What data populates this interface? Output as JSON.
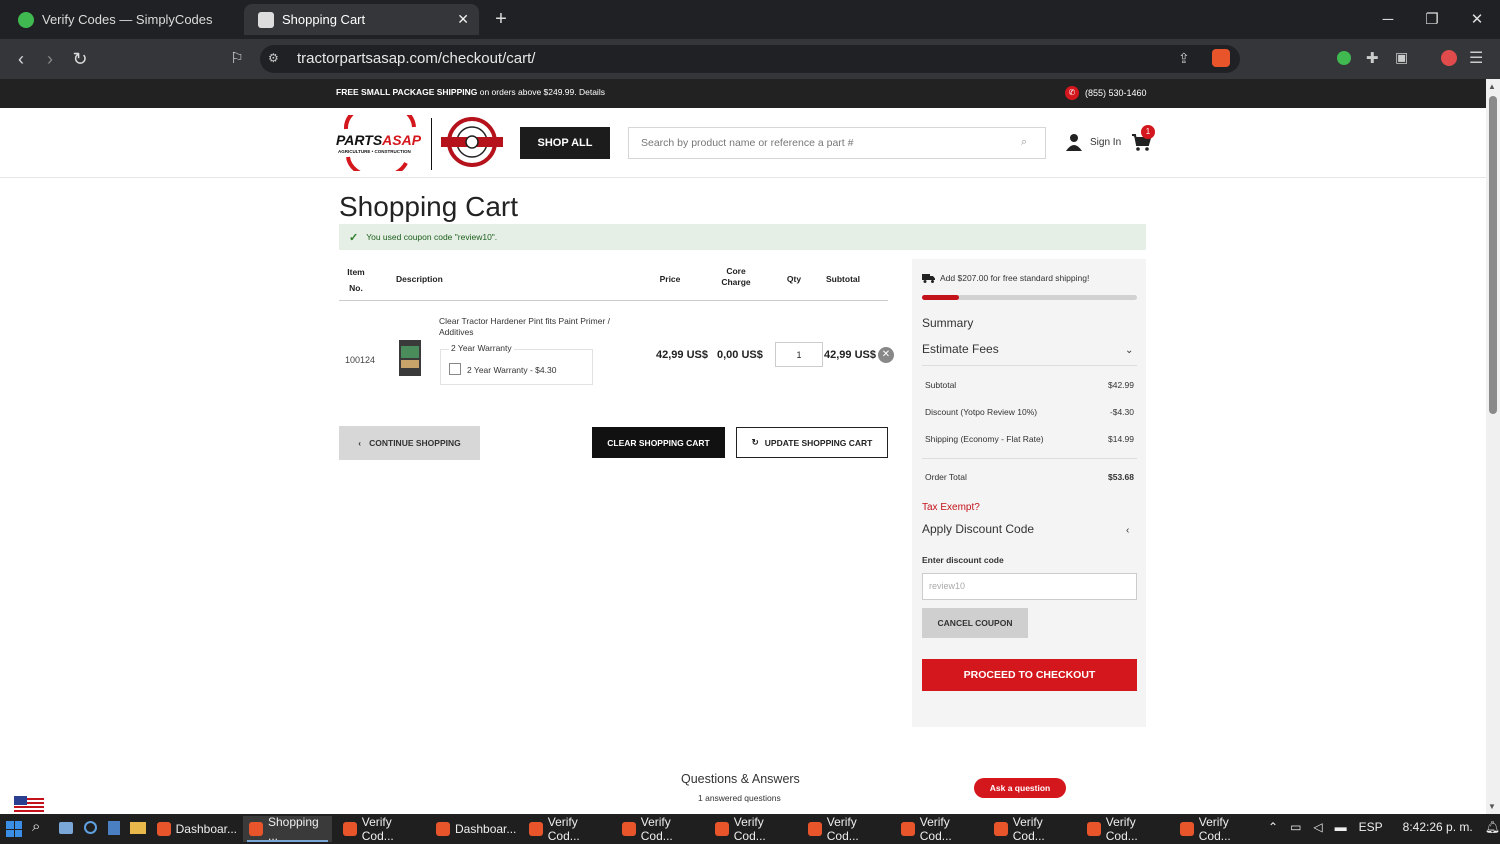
{
  "browser": {
    "tabs": [
      {
        "label": "Verify Codes — SimplyCodes",
        "active": false
      },
      {
        "label": "Shopping Cart",
        "active": true
      }
    ],
    "url": "tractorpartsasap.com/checkout/cart/"
  },
  "site": {
    "promo_bold": "FREE SMALL PACKAGE SHIPPING",
    "promo_rest": " on orders above $249.99. Details",
    "phone": "(855) 530-1460",
    "shop_all": "SHOP ALL",
    "search_placeholder": "Search by product name or reference a part #",
    "sign_in": "Sign In",
    "cart_count": "1",
    "logo_text": "PARTSASAP",
    "logo_sub": "AGRICULTURE • CONSTRUCTION"
  },
  "cart": {
    "title": "Shopping Cart",
    "coupon_message": "You used coupon code \"review10\".",
    "headers": {
      "item_no_1": "Item",
      "item_no_2": "No.",
      "description": "Description",
      "price": "Price",
      "core_1": "Core",
      "core_2": "Charge",
      "qty": "Qty",
      "subtotal": "Subtotal"
    },
    "item": {
      "item_no": "100124",
      "description": "Clear Tractor Hardener Pint fits Paint Primer / Additives",
      "warranty_label": "2 Year Warranty",
      "warranty_option": "2 Year Warranty - $4.30",
      "price": "42,99 US$",
      "core_charge": "0,00 US$",
      "qty": "1",
      "subtotal": "42,99 US$"
    },
    "continue_shopping": "CONTINUE SHOPPING",
    "clear_cart": "CLEAR SHOPPING CART",
    "update_cart": "UPDATE SHOPPING CART"
  },
  "summary": {
    "free_shipping": "Add $207.00 for free standard shipping!",
    "free_shipping_progress": 0.17,
    "title": "Summary",
    "estimate_fees": "Estimate Fees",
    "lines": [
      {
        "label": "Subtotal",
        "value": "$42.99"
      },
      {
        "label": "Discount (Yotpo Review 10%)",
        "value": "-$4.30"
      },
      {
        "label": "Shipping (Economy - Flat Rate)",
        "value": "$14.99"
      }
    ],
    "order_total_label": "Order Total",
    "order_total": "$53.68",
    "tax_exempt": "Tax Exempt?",
    "apply_discount": "Apply Discount Code",
    "enter_discount": "Enter discount code",
    "discount_value": "review10",
    "cancel_coupon": "CANCEL COUPON",
    "checkout": "PROCEED TO CHECKOUT"
  },
  "qa": {
    "title": "Questions & Answers",
    "count": "1 answered questions",
    "ask": "Ask a question"
  },
  "taskbar": {
    "items": [
      "Dashboar...",
      "Shopping ...",
      "Verify Cod...",
      "Dashboar...",
      "Verify Cod...",
      "Verify Cod...",
      "Verify Cod...",
      "Verify Cod...",
      "Verify Cod...",
      "Verify Cod...",
      "Verify Cod...",
      "Verify Cod..."
    ],
    "lang": "ESP",
    "time": "8:42:26 p. m."
  },
  "colors": {
    "brand_red": "#d4161d",
    "dark": "#1c1c1c"
  }
}
